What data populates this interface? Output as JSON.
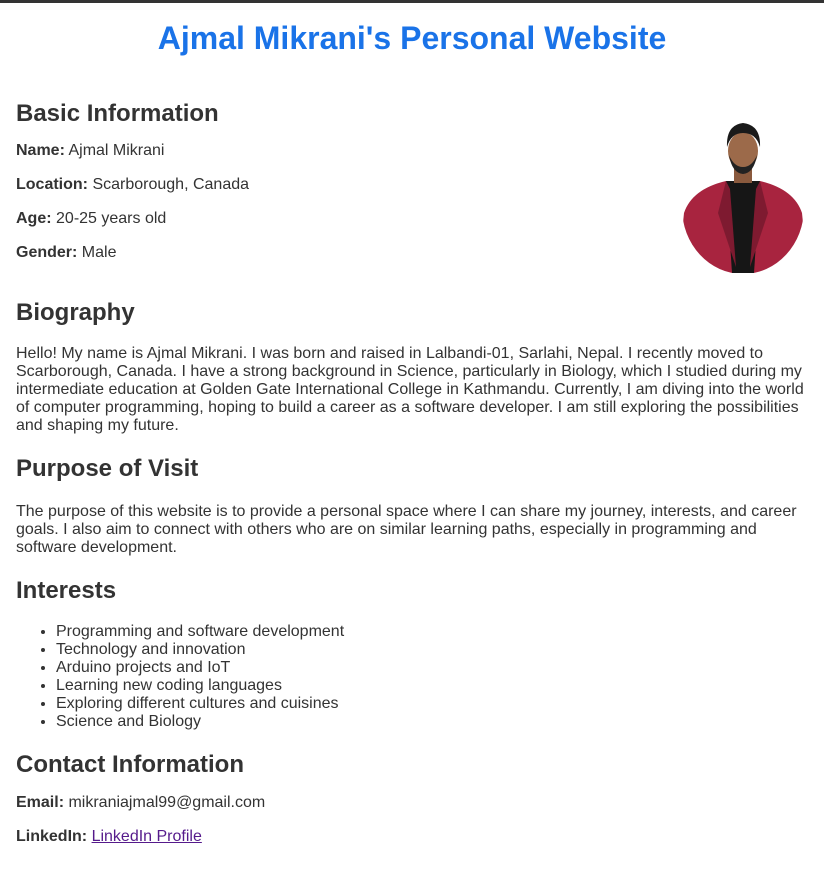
{
  "header": {
    "title": "Ajmal Mikrani's Personal Website"
  },
  "basic": {
    "heading": "Basic Information",
    "name_label": "Name:",
    "name_value": "Ajmal Mikrani",
    "location_label": "Location:",
    "location_value": "Scarborough, Canada",
    "age_label": "Age:",
    "age_value": "20-25 years old",
    "gender_label": "Gender:",
    "gender_value": "Male"
  },
  "biography": {
    "heading": "Biography",
    "text": "Hello! My name is Ajmal Mikrani. I was born and raised in Lalbandi-01, Sarlahi, Nepal. I recently moved to Scarborough, Canada. I have a strong background in Science, particularly in Biology, which I studied during my intermediate education at Golden Gate International College in Kathmandu. Currently, I am diving into the world of computer programming, hoping to build a career as a software developer. I am still exploring the possibilities and shaping my future."
  },
  "purpose": {
    "heading": "Purpose of Visit",
    "text": "The purpose of this website is to provide a personal space where I can share my journey, interests, and career goals. I also aim to connect with others who are on similar learning paths, especially in programming and software development."
  },
  "interests": {
    "heading": "Interests",
    "items": [
      "Programming and software development",
      "Technology and innovation",
      "Arduino projects and IoT",
      "Learning new coding languages",
      "Exploring different cultures and cuisines",
      "Science and Biology"
    ]
  },
  "contact": {
    "heading": "Contact Information",
    "email_label": "Email:",
    "email_value": "mikraniajmal99@gmail.com",
    "linkedin_label": "LinkedIn:",
    "linkedin_link": "LinkedIn Profile"
  },
  "colors": {
    "title": "#1a73e8",
    "text": "#333333",
    "visited_link": "#551a8b",
    "jacket": "#a8243f"
  }
}
